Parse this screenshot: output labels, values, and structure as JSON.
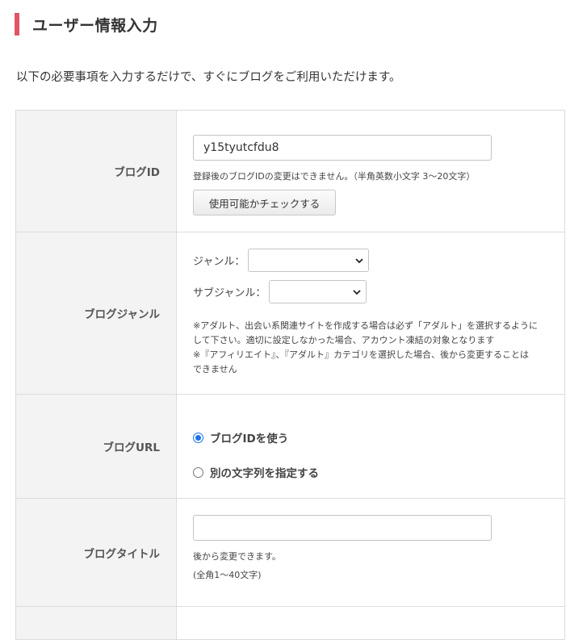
{
  "heading": {
    "title": "ユーザー情報入力"
  },
  "intro": "以下の必要事項を入力するだけで、すぐにブログをご利用いただけます。",
  "colors": {
    "accent_bar": "#e05566",
    "radio_selected": "#1a73e8",
    "label_bg": "#f3f3f3"
  },
  "blog_id": {
    "label": "ブログID",
    "value": "y15tyutcfdu8",
    "note": "登録後のブログIDの変更はできません。（半角英数小文字 3〜20文字）",
    "check_button": "使用可能かチェックする"
  },
  "blog_genre": {
    "label": "ブログジャンル",
    "genre_label": "ジャンル：",
    "subgenre_label": "サブジャンル：",
    "note_line1": "※アダルト、出会い系関連サイトを作成する場合は必ず「アダルト」を選択するように",
    "note_line2": "して下さい。適切に設定しなかった場合、アカウント凍結の対象となります",
    "note_line3": "※『アフィリエイト』、『アダルト』カテゴリを選択した場合、後から変更することは",
    "note_line4": "できません"
  },
  "blog_url": {
    "label": "ブログURL",
    "option_use_id": "ブログIDを使う",
    "option_custom": "別の文字列を指定する",
    "selected": "use_id"
  },
  "blog_title": {
    "label": "ブログタイトル",
    "value": "",
    "note_line1": "後から変更できます。",
    "note_line2": "(全角1〜40文字)"
  }
}
